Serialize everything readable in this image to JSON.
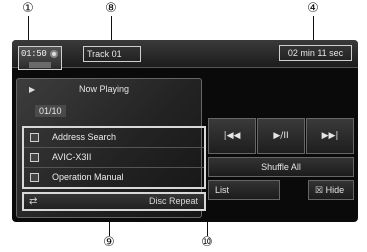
{
  "callouts": {
    "c1": "①",
    "c8": "⑧",
    "c4": "④",
    "c9": "⑨",
    "c10": "⑩"
  },
  "status": {
    "clock": "01:50",
    "track": "Track  01",
    "elapsed": "02 min   11 sec"
  },
  "now_playing": {
    "play_icon": "▶",
    "label": "Now Playing",
    "count": "01/10"
  },
  "menu": {
    "items": [
      {
        "label": "Address Search",
        "icon": "address-search-icon"
      },
      {
        "label": "AVIC-X3II",
        "icon": "device-icon"
      },
      {
        "label": "Operation Manual",
        "icon": "manual-icon"
      }
    ]
  },
  "repeat": {
    "icon": "⇄",
    "label": "Disc Repeat"
  },
  "controls": {
    "prev": "|◀◀",
    "play_pause": "▶/II",
    "next": "▶▶|",
    "shuffle": "Shuffle All",
    "list": "List",
    "hide": "☒ Hide"
  }
}
